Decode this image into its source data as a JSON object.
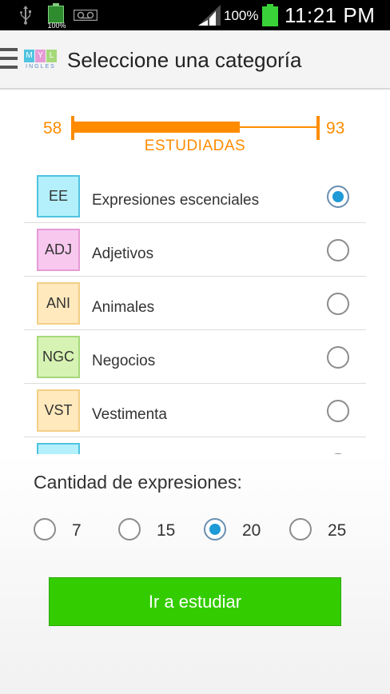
{
  "status_bar": {
    "battery_small_label": "100%",
    "battery_percent": "100%",
    "time": "11:21 PM"
  },
  "action_bar": {
    "title": "Seleccione una categoría",
    "logo_letters": [
      "M",
      "Y",
      "L"
    ],
    "logo_word": "INGLES"
  },
  "progress": {
    "min": "58",
    "max": "93",
    "label": "ESTUDIADAS",
    "fill_fraction": 0.68,
    "color": "#ff8c00"
  },
  "categories": [
    {
      "code": "EE",
      "label": "Expresiones escenciales",
      "selected": true,
      "bg": "#b3f0fb",
      "border": "#4fc3e0"
    },
    {
      "code": "ADJ",
      "label": "Adjetivos",
      "selected": false,
      "bg": "#f8c8ef",
      "border": "#e59bd6"
    },
    {
      "code": "ANI",
      "label": "Animales",
      "selected": false,
      "bg": "#ffe9bd",
      "border": "#f2cf86"
    },
    {
      "code": "NGC",
      "label": "Negocios",
      "selected": false,
      "bg": "#d6f3b3",
      "border": "#a6d97a"
    },
    {
      "code": "VST",
      "label": "Vestimenta",
      "selected": false,
      "bg": "#ffe9bd",
      "border": "#f2cf86"
    },
    {
      "code": "",
      "label": "",
      "selected": false,
      "bg": "#b3f0fb",
      "border": "#4fc3e0"
    }
  ],
  "quantity": {
    "label": "Cantidad de expresiones:",
    "options": [
      {
        "value": "7",
        "selected": false
      },
      {
        "value": "15",
        "selected": false
      },
      {
        "value": "20",
        "selected": true
      },
      {
        "value": "25",
        "selected": false
      }
    ]
  },
  "action_button": {
    "label": "Ir a estudiar",
    "color": "#33cc00"
  }
}
